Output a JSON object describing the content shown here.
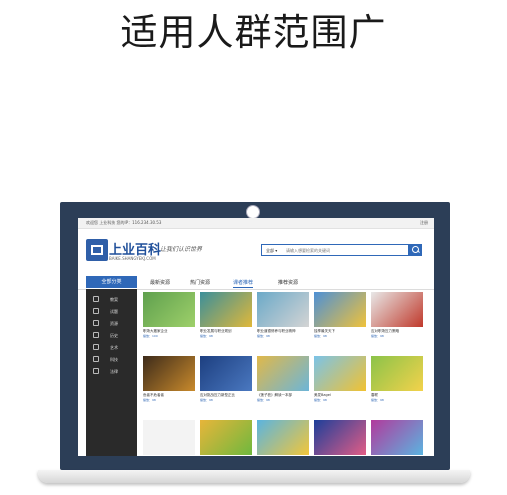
{
  "headline": "适用人群范围广",
  "topbar": {
    "left": "欢迎您 上业科技  您的IP：116.234.30.53",
    "right": "注册"
  },
  "site": {
    "name": "上业百科",
    "domain": "BAIKE.SHANGYEKJ.COM",
    "slogan": "让我们认识世界"
  },
  "search": {
    "category": "全部 ▾",
    "placeholder": "请输入想要检索的关键词"
  },
  "nav": {
    "all_label": "全部分类",
    "tabs": [
      "最新资源",
      "热门资源",
      "课者推荐",
      "推荐资源"
    ],
    "active_index": 2
  },
  "sidebar": {
    "items": [
      "教案",
      "试题",
      "资源",
      "历史",
      "艺术",
      "科技",
      "法律"
    ]
  },
  "cards": [
    {
      "title": "职场大搬家企业",
      "meta": "播放：100",
      "color1": "#5fa04e",
      "color2": "#9ed06a"
    },
    {
      "title": "职业发展与职业规划",
      "meta": "播放：98",
      "color1": "#3b8f9a",
      "color2": "#e0b83a"
    },
    {
      "title": "职业道德修养与职业精神",
      "meta": "播放：98",
      "color1": "#6ba9c8",
      "color2": "#d4d4d4"
    },
    {
      "title": "独享最关天下",
      "meta": "播放：98",
      "color1": "#4d90d6",
      "color2": "#f0c23a"
    },
    {
      "title": "应对职场压力策略",
      "meta": "播放：98",
      "color1": "#e8e8e8",
      "color2": "#c0392b"
    },
    {
      "title": "危者不危者者",
      "meta": "播放：98",
      "color1": "#3d2b1a",
      "color2": "#c98a2c"
    },
    {
      "title": "应对挑战压力新型正比",
      "meta": "播放：98",
      "color1": "#1d3f80",
      "color2": "#4a78c0"
    },
    {
      "title": "《莲子桩》解读一本部",
      "meta": "播放：98",
      "color1": "#e0b84a",
      "color2": "#6cb5d8"
    },
    {
      "title": "美发Bagel",
      "meta": "播放：98",
      "color1": "#7bc3e8",
      "color2": "#f1c232"
    },
    {
      "title": "春联",
      "meta": "播放：98",
      "color1": "#8bc34a",
      "color2": "#f3d24b"
    },
    {
      "title": "飞翔的蒲公英",
      "meta": "",
      "color1": "#f3f3f3",
      "color2": "#f3f3f3"
    },
    {
      "title": "",
      "meta": "",
      "color1": "#e7b53a",
      "color2": "#6fb83e"
    },
    {
      "title": "",
      "meta": "",
      "color1": "#5bb4e0",
      "color2": "#f2c63a"
    },
    {
      "title": "",
      "meta": "",
      "color1": "#1d3f9a",
      "color2": "#e25d86"
    },
    {
      "title": "",
      "meta": "",
      "color1": "#b23a9c",
      "color2": "#5bb4e0"
    }
  ]
}
